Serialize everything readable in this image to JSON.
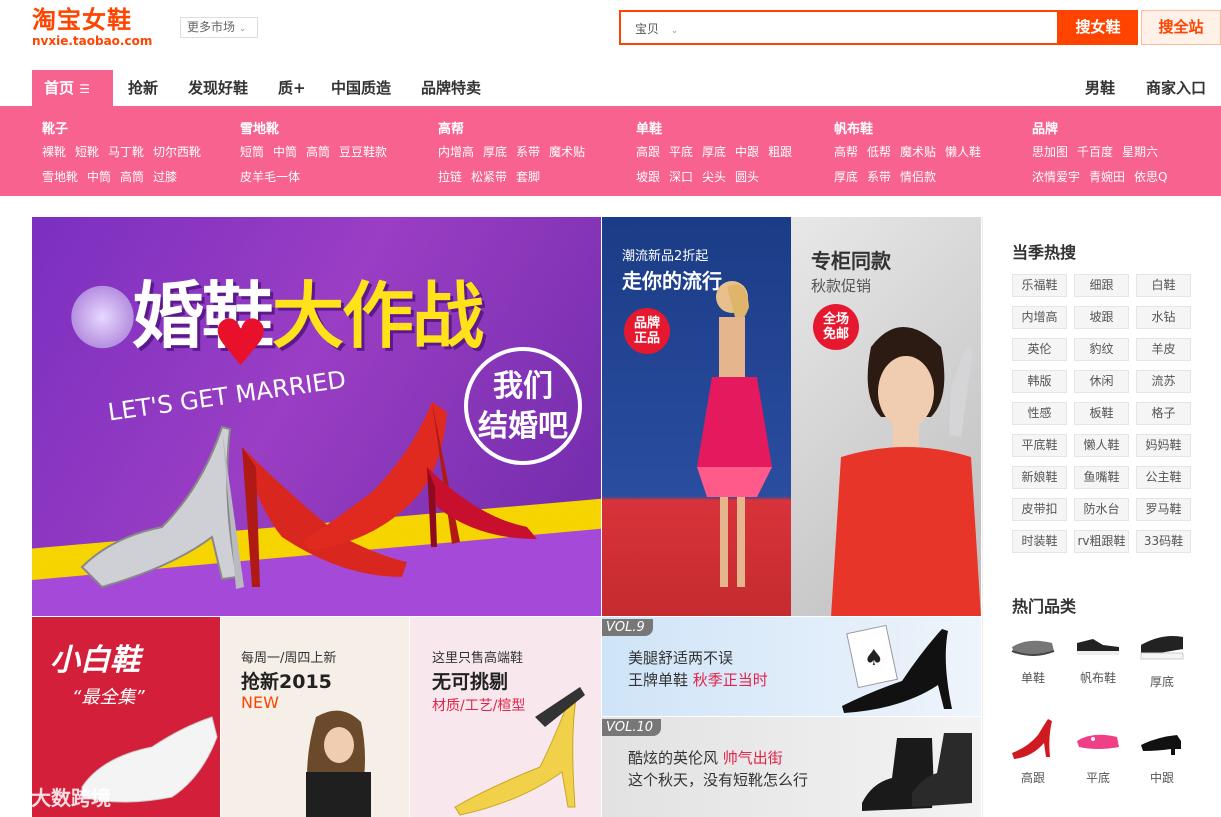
{
  "header": {
    "logo_title": "淘宝女鞋",
    "logo_domain": "nvxie.taobao.com",
    "more_markets": "更多市场",
    "search_category": "宝贝",
    "search_placeholder": "",
    "search_button": "搜女鞋",
    "search_all_button": "搜全站"
  },
  "nav": {
    "items": [
      "首页",
      "抢新",
      "发现好鞋",
      "质+",
      "中国质造",
      "品牌特卖"
    ],
    "right_items": [
      "男鞋",
      "商家入口"
    ]
  },
  "categories": [
    {
      "title": "靴子",
      "rows": [
        [
          "裸靴",
          "短靴",
          "马丁靴",
          "切尔西靴"
        ],
        [
          "雪地靴",
          "中筒",
          "高筒",
          "过膝"
        ]
      ]
    },
    {
      "title": "雪地靴",
      "rows": [
        [
          "短筒",
          "中筒",
          "高筒",
          "豆豆鞋款"
        ],
        [
          "皮羊毛一体"
        ]
      ]
    },
    {
      "title": "高帮",
      "rows": [
        [
          "内增高",
          "厚底",
          "系带",
          "魔术贴"
        ],
        [
          "拉链",
          "松紧带",
          "套脚"
        ]
      ]
    },
    {
      "title": "单鞋",
      "rows": [
        [
          "高跟",
          "平底",
          "厚底",
          "中跟",
          "粗跟"
        ],
        [
          "坡跟",
          "深口",
          "尖头",
          "圆头"
        ]
      ]
    },
    {
      "title": "帆布鞋",
      "rows": [
        [
          "高帮",
          "低帮",
          "魔术贴",
          "懒人鞋"
        ],
        [
          "厚底",
          "系带",
          "情侣款"
        ]
      ]
    },
    {
      "title": "品牌",
      "rows": [
        [
          "思加图",
          "千百度",
          "星期六"
        ],
        [
          "浓情爱宇",
          "青婉田",
          "依思Q"
        ]
      ]
    }
  ],
  "banner_main": {
    "title_a": "婚鞋",
    "title_b": "大作战",
    "subtitle": "LET'S GET MARRIED",
    "circle_line1": "我们",
    "circle_line2": "结婚吧",
    "slide_count": 7,
    "active_slide": 1
  },
  "banner_2": {
    "line1": "潮流新品2折起",
    "line2": "走你的流行",
    "badge_l1": "品牌",
    "badge_l2": "正品"
  },
  "banner_3": {
    "line1": "专柜同款",
    "line2": "秋款促销",
    "badge_l1": "全场",
    "badge_l2": "免邮"
  },
  "sidebar": {
    "hot_search_title": "当季热搜",
    "hot_tags": [
      "乐福鞋",
      "细跟",
      "白鞋",
      "内增高",
      "坡跟",
      "水钻",
      "英伦",
      "豹纹",
      "羊皮",
      "韩版",
      "休闲",
      "流苏",
      "性感",
      "板鞋",
      "格子",
      "平底鞋",
      "懒人鞋",
      "妈妈鞋",
      "新娘鞋",
      "鱼嘴鞋",
      "公主鞋",
      "皮带扣",
      "防水台",
      "罗马鞋",
      "时装鞋",
      "rv粗跟鞋",
      "33码鞋"
    ],
    "hot_category_title": "热门品类",
    "hot_categories": [
      "单鞋",
      "帆布鞋",
      "厚底",
      "高跟",
      "平底",
      "中跟"
    ]
  },
  "tiles": {
    "t1_a": "小白鞋",
    "t1_b": "“最全集”",
    "t2_a": "每周一/周四上新",
    "t2_b": "抢新2015",
    "t2_c": "NEW",
    "t3_a": "这里只售高端鞋",
    "t3_b": "无可挑剔",
    "t3_c": "材质/工艺/楦型",
    "t4_vol": "VOL.9",
    "t4_l1": "美腿舒适两不误",
    "t4_l2": "王牌单鞋",
    "t4_l2b": "秋季正当时",
    "t5_vol": "VOL.10",
    "t5_l1": "酷炫的英伦风",
    "t5_l1b": "帅气出街",
    "t5_l2": "这个秋天，没有短靴怎么行"
  },
  "watermark": "大数跨境",
  "colors": {
    "brand": "#ff4400",
    "pink": "#f7628f"
  }
}
